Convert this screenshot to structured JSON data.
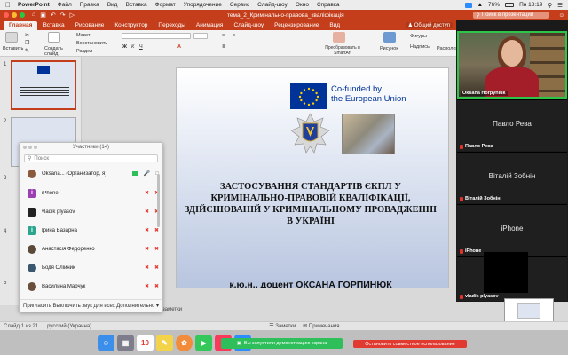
{
  "menubar": {
    "apple": "",
    "items": [
      "PowerPoint",
      "Файл",
      "Правка",
      "Вид",
      "Вставка",
      "Формат",
      "Упорядочение",
      "Сервис",
      "Слайд-шоу",
      "Окно",
      "Справка"
    ],
    "battery": "76%",
    "clock": "Пн 18:19"
  },
  "titlebar": {
    "doc_title": "тема_2_Кримінально-правова_кваліфікація",
    "search_placeholder": "Поиск в презентации"
  },
  "ribbon_tabs": {
    "tabs": [
      "Главная",
      "Вставка",
      "Рисование",
      "Конструктор",
      "Переходы",
      "Анимация",
      "Слайд-шоу",
      "Рецензирование",
      "Вид"
    ],
    "share": "Общий доступ"
  },
  "ribbon": {
    "paste": "Вставить",
    "new_slide": "Создать слайд",
    "layout": "Макет",
    "reset": "Восстановить",
    "section": "Раздел",
    "convert_smartart": "Преобразовать в SmartArt",
    "picture": "Рисунок",
    "shapes": "Фигуры",
    "textbox": "Надпись",
    "arrange": "Расположить"
  },
  "thumbnails": {
    "numbers": [
      "1",
      "2",
      "3",
      "4",
      "5"
    ]
  },
  "slide": {
    "eu_text_line1": "Co-funded by",
    "eu_text_line2": "the European Union",
    "title": "ЗАСТОСУВАННЯ СТАНДАРТІВ ЄКПЛ У КРИМІНАЛЬНО-ПРАВОВІЙ КВАЛІФІКАЦІЇ, ЗДІЙСНЮВАНІЙ У КРИМІНАЛЬНОМУ ПРОВАДЖЕННІ В УКРАЇНІ",
    "author": "к.ю.н., доцент ОКСАНА ГОРПИНЮК"
  },
  "participants": {
    "header": "Участники (14)",
    "search_placeholder": "Поиск",
    "rows": [
      {
        "initial": "",
        "name": "Oksana... (Организатор, я)",
        "avatar_color": "#8a5a3c"
      },
      {
        "initial": "i",
        "name": "iPhone",
        "avatar_color": "#9b3fb3"
      },
      {
        "initial": "",
        "name": "vladik plyasov",
        "avatar_color": "#222222"
      },
      {
        "initial": "i",
        "name": "Ірина Базарна",
        "avatar_color": "#2ca58d"
      },
      {
        "initial": "",
        "name": "Анастасія Федоренко",
        "avatar_color": "#5b4a3a"
      },
      {
        "initial": "",
        "name": "Бодя Олійник",
        "avatar_color": "#3a5770"
      },
      {
        "initial": "",
        "name": "Василина Марчук",
        "avatar_color": "#6b4d3c"
      }
    ],
    "invite": "Пригласить",
    "mute_all": "Выключить звук для всех",
    "more": "Дополнительно"
  },
  "video": {
    "self_label": "Oksana Horpyniuk",
    "tiles": [
      {
        "center": "Павло Рева",
        "corner": "Павло Рева"
      },
      {
        "center": "Віталій Зобнін",
        "corner": "Віталій Зобнін"
      },
      {
        "center": "iPhone",
        "corner": "iPhone"
      },
      {
        "center": "",
        "corner": "vladik plyasov"
      }
    ]
  },
  "status": {
    "slide_info": "Слайд 1 из 21",
    "language": "русский (Украина)",
    "notes": "Заметки",
    "comments": "Примечания",
    "notes_area": "заметки"
  },
  "share": {
    "banner": "Вы запустили демонстрацию экрана",
    "stop": "Остановить совместное использование"
  },
  "colors": {
    "brand": "#c43e1c",
    "zoom_green": "#2fbf5a",
    "stop_red": "#e03a31",
    "eu_blue": "#003399"
  }
}
